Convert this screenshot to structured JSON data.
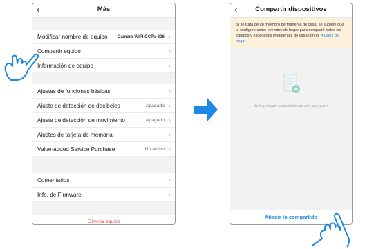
{
  "left_screen": {
    "back_icon": "‹",
    "title": "Más",
    "section1": [
      {
        "label": "Modificar nombre de equipo",
        "value": "Cámara WIFI CCTV-206"
      },
      {
        "label": "Compartir equipo",
        "value": ""
      },
      {
        "label": "Información de equipo",
        "value": ""
      }
    ],
    "section2": [
      {
        "label": "Ajustes de funciones básicas",
        "value": ""
      },
      {
        "label": "Ajuste de detección de decibeles",
        "value": "Apagado"
      },
      {
        "label": "Ajuste de detección de movimiento",
        "value": "Apagado"
      },
      {
        "label": "Ajustes de tarjeta de memoria",
        "value": ""
      },
      {
        "label": "Value-added Service Purchase",
        "value": "No activo"
      }
    ],
    "section3": [
      {
        "label": "Comentarios",
        "value": ""
      },
      {
        "label": "Info. de Firmware",
        "value": ""
      }
    ],
    "delete_label": "Eliminar equipo",
    "chevron": "›"
  },
  "right_screen": {
    "back_icon": "‹",
    "title": "Compartir dispositivos",
    "banner_text": "Si se trata de un miembro permanente de casa, se sugiere que lo configure como miembro de hogar para compartir todos los equipos y escenarios inteligentes de casa con él.",
    "banner_link": "Ajustes del hogar",
    "empty_text": "No hay ningún compartimiento aún, agréguelo",
    "add_button": "Añadir lo compartido"
  },
  "colors": {
    "accent_blue": "#1e88e5",
    "arrow_blue": "#1e88e5",
    "delete_red": "#e53935",
    "banner_bg": "#fdf1db"
  },
  "icons": [
    "back-icon",
    "chevron-right-icon",
    "pointing-hand-icon",
    "right-arrow-icon",
    "document-share-icon"
  ]
}
